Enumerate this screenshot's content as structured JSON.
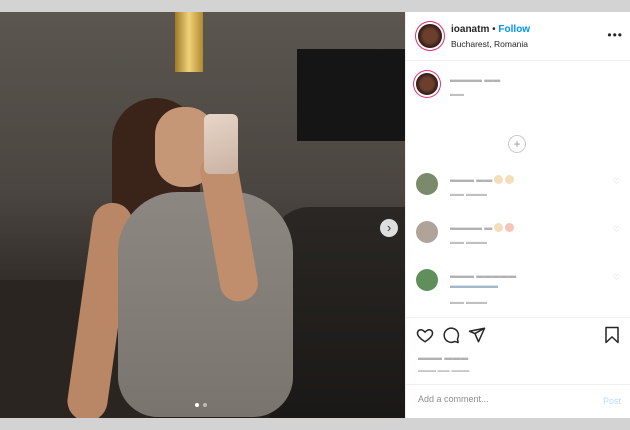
{
  "header": {
    "username": "ioanatm",
    "separator": "•",
    "follow_label": "Follow",
    "location": "Bucharest, Romania",
    "more_icon": "more-dots-icon"
  },
  "actions": {
    "like_icon": "heart-icon",
    "comment_icon": "comment-icon",
    "share_icon": "share-icon",
    "save_icon": "bookmark-icon"
  },
  "add_comment": {
    "placeholder": "Add a comment...",
    "post_label": "Post"
  },
  "colors": {
    "link": "#0095f6",
    "post_disabled": "#b2dffc",
    "text": "#262626"
  }
}
